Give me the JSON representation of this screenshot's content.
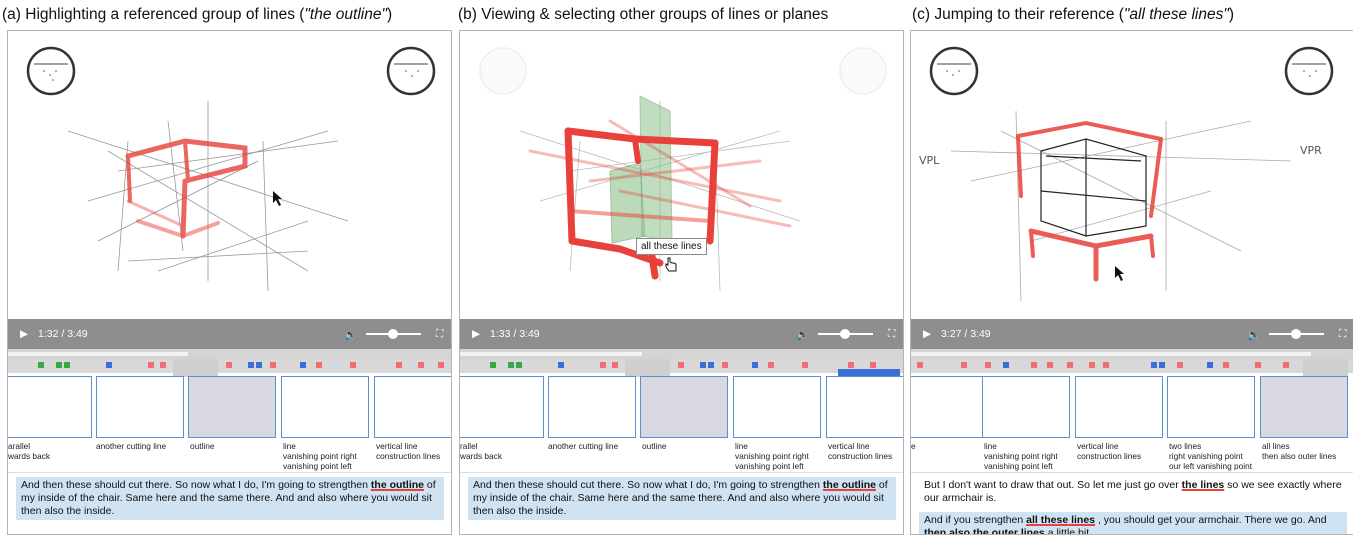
{
  "panels": [
    {
      "caption": "(a) Highlighting a referenced group of lines (",
      "caption_quote": "\"the outline\"",
      "caption_tail": ")",
      "time": "1:32 / 3:49",
      "thumbs": [
        {
          "label": "arallel\nwards back",
          "active": false
        },
        {
          "label": "another cutting line",
          "active": false
        },
        {
          "label": "outline",
          "active": true
        },
        {
          "label": "line\nvanishing point right\nvanishing point left",
          "active": false
        },
        {
          "label": "vertical line\nconstruction lines",
          "active": false
        }
      ],
      "transcript": [
        {
          "pre": "And then these should cut there. So now what I do, I'm going to strengthen ",
          "bold": "the outline",
          "post": " of my inside of the chair. Same here and the same there. And and also where you would sit then also the inside.",
          "highlight": true
        }
      ]
    },
    {
      "caption": "(b) Viewing & selecting other groups of lines or planes",
      "caption_quote": "",
      "caption_tail": "",
      "time": "1:33 / 3:49",
      "tooltip": "all these lines",
      "thumbs": [
        {
          "label": "rallel\nwards back",
          "active": false
        },
        {
          "label": "another cutting line",
          "active": false
        },
        {
          "label": "outline",
          "active": true
        },
        {
          "label": "line\nvanishing point right\nvanishing point left",
          "active": false
        },
        {
          "label": "vertical line\nconstruction lines",
          "active": false
        }
      ],
      "transcript": [
        {
          "pre": "And then these should cut there. So now what I do, I'm going to strengthen ",
          "bold": "the outline",
          "post": " of my inside of the chair. Same here and the same there. And and also where you would sit then also the inside.",
          "highlight": true
        }
      ]
    },
    {
      "caption": "(c) Jumping to their reference (",
      "caption_quote": "\"all these lines\"",
      "caption_tail": ")",
      "time": "3:27 / 3:49",
      "handwriting_left": "VPL",
      "handwriting_right": "VPR",
      "thumbs": [
        {
          "label": "e",
          "active": false
        },
        {
          "label": "line\nvanishing point right\nvanishing point left",
          "active": false
        },
        {
          "label": "vertical line\nconstruction lines",
          "active": false
        },
        {
          "label": "two lines\nright vanishing point\nour left vanishing point",
          "active": false
        },
        {
          "label": "all lines\nthen also outer lines",
          "active": true
        }
      ],
      "transcript": [
        {
          "pre": "But I don't want to draw that out. So let me just go over ",
          "bold": "the lines",
          "post": " so we see exactly where our armchair is.",
          "highlight": false
        },
        {
          "pre": "And if you strengthen ",
          "bold": "all these lines",
          "post": " , you should get your armchair. There we go. And ",
          "bold2": "then also the outer lines",
          "post2": " a little bit.",
          "highlight": true
        }
      ]
    }
  ],
  "colors": {
    "highlight_red": "#e8403a",
    "plane_green": "#8fc28c",
    "transcript_bg": "#cfe3f3",
    "marker_green": "#3aa84a",
    "marker_blue": "#3a6fd6",
    "marker_red": "#f07070"
  }
}
